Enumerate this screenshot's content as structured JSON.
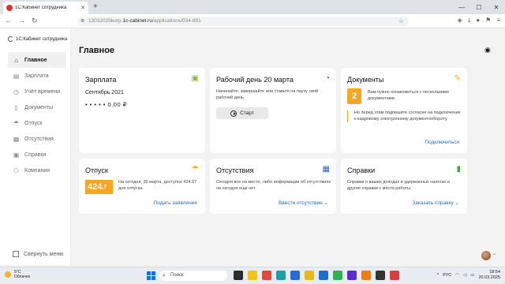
{
  "browser": {
    "tab_title": "1С:Кабинет сотрудника",
    "tab_close": "✕",
    "new_tab": "+",
    "url_prefix": "13032025korp.",
    "url_host": "1c-cabinet.ru",
    "url_path": "/applications/034-891",
    "window_controls": [
      "—",
      "☐",
      "✕"
    ]
  },
  "sidebar": {
    "logo_text": "1С:Кабинет сотрудника",
    "items": [
      {
        "label": "Главное",
        "icon": "home-icon",
        "active": true
      },
      {
        "label": "Зарплата",
        "icon": "wallet-icon",
        "active": false
      },
      {
        "label": "Учёт времени",
        "icon": "clock-icon",
        "active": false
      },
      {
        "label": "Документы",
        "icon": "document-icon",
        "active": false
      },
      {
        "label": "Отпуск",
        "icon": "beach-icon",
        "active": false
      },
      {
        "label": "Отсутствия",
        "icon": "calendar-icon",
        "active": false
      },
      {
        "label": "Справки",
        "icon": "certificate-icon",
        "active": false
      },
      {
        "label": "Компания",
        "icon": "people-icon",
        "active": false
      }
    ],
    "collapse_label": "Свернуть меню"
  },
  "page": {
    "title": "Главное"
  },
  "cards": {
    "salary": {
      "title": "Зарплата",
      "month": "Сентябрь 2021",
      "amount": "• • • • • 0.00 ₽"
    },
    "workday": {
      "title": "Рабочий день 20 марта",
      "text": "Начинайте, завершайте или ставьте на паузу свой рабочий день",
      "button": "Старт"
    },
    "documents": {
      "title": "Документы",
      "count": "2",
      "text": "Вам нужно ознакомиться с несколькими документами.",
      "note": "Но перед этим подпишите согласие на подключение к кадровому электронному документообороту.",
      "link": "Подключиться"
    },
    "vacation": {
      "title": "Отпуск",
      "days_int": "424",
      "days_frac": ",7",
      "text": "На сегодня, 20 марта, доступно 424.67 дня отпуска.",
      "link": "Подать заявление"
    },
    "absences": {
      "title": "Отсутствия",
      "text": "Сегодня все на месте, либо информации об отсутствиях на сегодня еще нет.",
      "link": "Ввести отсутствие ⌄"
    },
    "references": {
      "title": "Справки",
      "text": "Справки о ваших доходах и удержанных налогах и другие справки с места работы.",
      "link": "Заказать справку ⌄"
    }
  },
  "taskbar": {
    "temperature": "5°C",
    "weather": "Облачно",
    "search_placeholder": "Поиск",
    "lang": "РУС",
    "time": "18:54",
    "date": "20.03.2025"
  },
  "colors": {
    "accent_orange": "#f5a623",
    "link_blue": "#2a6ab6"
  }
}
